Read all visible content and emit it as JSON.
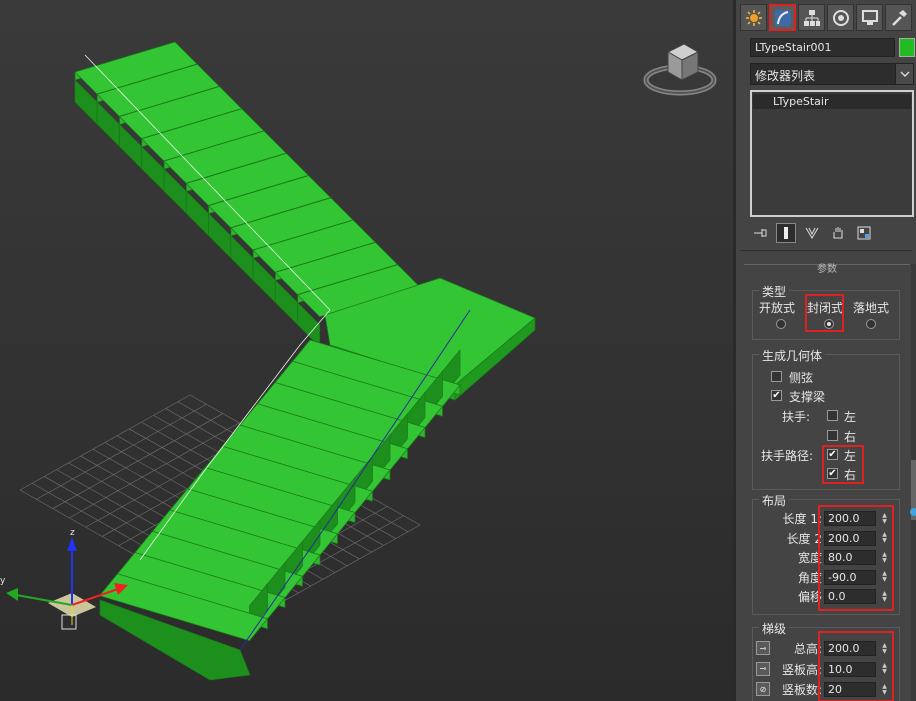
{
  "object": {
    "name": "LTypeStair001",
    "color": "#22bb22"
  },
  "modifier_list": {
    "label": "修改器列表"
  },
  "stack": {
    "items": [
      "LTypeStair"
    ]
  },
  "rollout": {
    "title": "参数",
    "type": {
      "title": "类型",
      "options": [
        "开放式",
        "封闭式",
        "落地式"
      ],
      "selected": "封闭式"
    },
    "geometry": {
      "title": "生成几何体",
      "stringers": "侧弦",
      "carriage": "支撑梁",
      "handrail_label": "扶手:",
      "handrail_left": "左",
      "handrail_right": "右",
      "rail_path_label": "扶手路径:",
      "rail_path_left": "左",
      "rail_path_right": "右"
    },
    "layout": {
      "title": "布局",
      "fields": [
        {
          "label": "长度 1:",
          "value": "200.0"
        },
        {
          "label": "长度 2",
          "value": "200.0"
        },
        {
          "label": "宽度",
          "value": "80.0"
        },
        {
          "label": "角度",
          "value": "-90.0"
        },
        {
          "label": "偏移",
          "value": "0.0"
        }
      ]
    },
    "steps": {
      "title": "梯级",
      "fields": [
        {
          "label": "总高:",
          "value": "200.0"
        },
        {
          "label": "竖板高:",
          "value": "10.0"
        },
        {
          "label": "竖板数:",
          "value": "20"
        }
      ]
    }
  },
  "viewport": {
    "gizmo_axes": [
      "x",
      "y",
      "z"
    ]
  }
}
